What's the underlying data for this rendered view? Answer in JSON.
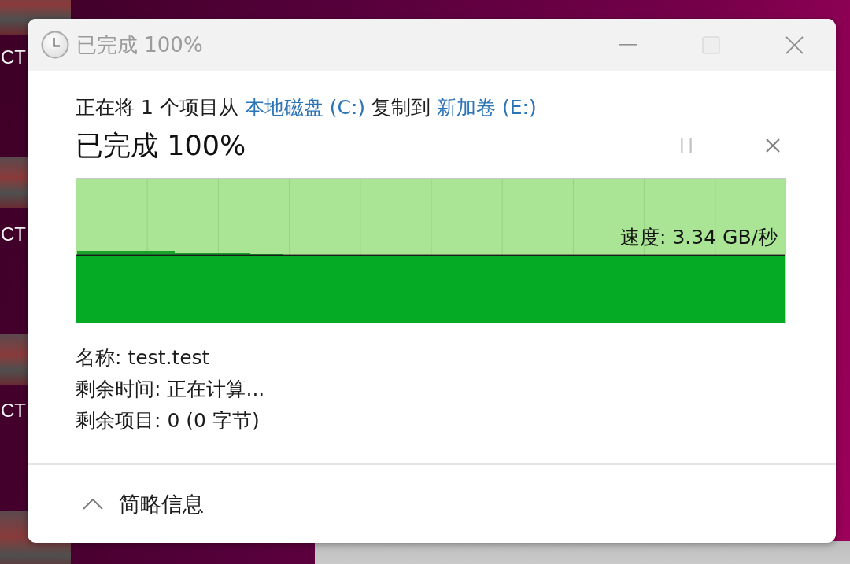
{
  "desktop": {
    "labels": [
      "CT",
      "CT",
      "CT"
    ]
  },
  "window": {
    "title": "已完成 100%",
    "controls": [
      {
        "kind": "minimize",
        "disabled": false
      },
      {
        "kind": "maximize",
        "disabled": true
      },
      {
        "kind": "close",
        "disabled": false
      }
    ]
  },
  "copy_line": [
    {
      "kind": "text",
      "text": "正在将 1 个项目从"
    },
    {
      "kind": "link",
      "text": "本地磁盘 (C:)"
    },
    {
      "kind": "text",
      "text": "复制到"
    },
    {
      "kind": "link",
      "text": "新加卷 (E:)"
    }
  ],
  "progress": {
    "heading": "已完成 100%",
    "buttons": [
      {
        "kind": "pause",
        "disabled": true
      },
      {
        "kind": "cancel",
        "disabled": false
      }
    ]
  },
  "graph": {
    "level": 1,
    "speed": "速度: 3.34 GB/秒"
  },
  "details": [
    {
      "label": "名称:",
      "value": "test.test"
    },
    {
      "label": "剩余时间:",
      "value": "正在计算..."
    },
    {
      "label": "剩余项目:",
      "value": "0 (0 字节)"
    }
  ],
  "footer": {
    "label": "简略信息",
    "expanded": true
  }
}
